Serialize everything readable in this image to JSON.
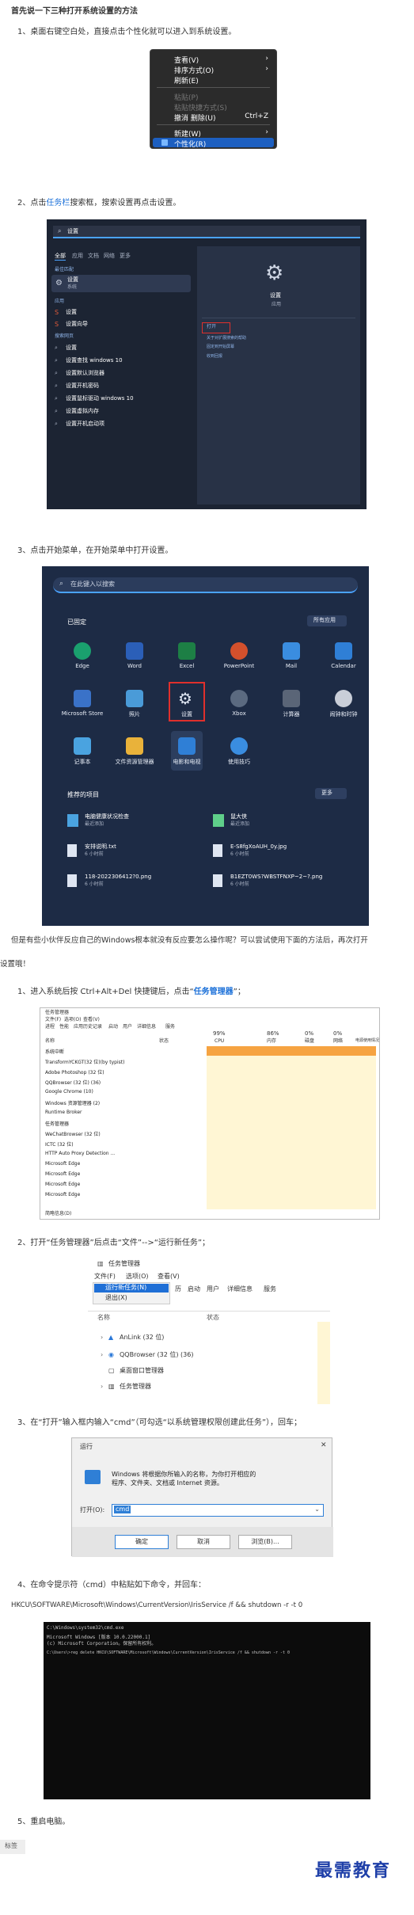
{
  "intro_heading": "首先说一下三种打开系统设置的方法",
  "step1": {
    "num": "1、",
    "text": "桌面右键空白处，直接点击个性化就可以进入到系统设置。"
  },
  "context_menu": {
    "items": [
      "查看(V)",
      "排序方式(O)",
      "刷新(E)",
      "粘贴(P)",
      "粘贴快捷方式(S)",
      "撤消 删除(U)",
      "新建(W)",
      "个性化(R)"
    ],
    "undo_shortcut": "Ctrl+Z"
  },
  "step2": {
    "num": "2、",
    "pre": "点击",
    "link": "任务栏",
    "post": "搜索框，搜索设置再点击设置。"
  },
  "search_panel": {
    "query": "设置",
    "tabs": [
      "全部",
      "应用",
      "文档",
      "网络",
      "更多"
    ],
    "best_match": "最佳匹配",
    "best_title": "设置",
    "best_sub": "系统",
    "apps_label": "应用",
    "apps": [
      "设置",
      "设置向导"
    ],
    "web_label": "搜索网页",
    "web": [
      "设置",
      "设置查找 windows 10",
      "设置默认浏览器",
      "设置开机密码",
      "设置鼠标驱动 windows 10",
      "设置虚拟内存",
      "设置开机启动项"
    ],
    "right_title": "设置",
    "right_sub": "应用",
    "actions": [
      "打开",
      "关于对扩展搜索的帮助",
      "固定到开始屏幕",
      "收到回报"
    ]
  },
  "step3": {
    "num": "3、",
    "text": "点击开始菜单，在开始菜单中打开设置。"
  },
  "start_menu": {
    "search": "在此键入以搜索",
    "pinned": "已固定",
    "all_apps": "所有应用",
    "apps": [
      "Edge",
      "Word",
      "Excel",
      "PowerPoint",
      "Mail",
      "Calendar",
      "Microsoft Store",
      "照片",
      "设置",
      "Xbox",
      "计算器",
      "闹钟和时钟",
      "记事本",
      "文件资源管理器",
      "电影和电视",
      "使用技巧"
    ],
    "recommended": "推荐的项目",
    "more": "更多",
    "recs": [
      {
        "title": "电脑健康状况检查",
        "sub": "最近添加"
      },
      {
        "title": "鼠大侠",
        "sub": "最近添加"
      },
      {
        "title": "安排说明.txt",
        "sub": "6 小时前"
      },
      {
        "title": "E-S8fgXoAUH_0y.jpg",
        "sub": "6 小时前"
      },
      {
        "title": "118-2022306412?0.png",
        "sub": "6 小时前"
      },
      {
        "title": "B1EZT0WS?WBSTFNXP~2~?.png",
        "sub": "6 小时前"
      }
    ]
  },
  "para": {
    "line1": "但是有些小伙伴反应自己的Windows根本就没有反应要怎么操作呢？可以尝试使用下面的方法后，再次打开",
    "line2": "设置哦！"
  },
  "s1": {
    "num": "1、",
    "pre": "进入系统后按 Ctrl+Alt+Del 快捷键后，点击“",
    "link": "任务管理器",
    "post": "”；"
  },
  "taskmgr": {
    "title": "任务管理器",
    "menu": [
      "文件(F)",
      "选项(O)",
      "查看(V)"
    ],
    "tabs": [
      "进程",
      "性能",
      "应用历史记录",
      "启动",
      "用户",
      "详细信息",
      "服务"
    ],
    "percents": [
      "99%",
      "86%",
      "0%",
      "0%"
    ],
    "cols": [
      "名称",
      "状态",
      "CPU",
      "内存",
      "磁盘",
      "网络",
      "电源使用情况"
    ],
    "rows": [
      "系统中断",
      "TransformYCKGT(32 位)(by typist)",
      "Adobe Photoshop (32 位)",
      "QQBrowser (32 位) (36)",
      "Google Chrome (10)",
      "Windows 资源管理器 (2)",
      "Runtime Broker",
      "任务管理器",
      "WeChatBrowser (32 位)",
      "ICTC (32 位)",
      "HTTP Auto Proxy Detection ...",
      "Microsoft Edge",
      "Microsoft Edge",
      "Microsoft Edge",
      "Microsoft Edge"
    ],
    "footer": "简略信息(D)"
  },
  "s2": {
    "num": "2、",
    "text": "打开“任务管理器”后点击“文件”-->“运行新任务”；"
  },
  "tm_menu": {
    "title": "任务管理器",
    "menu": [
      "文件(F)",
      "选项(O)",
      "查看(V)"
    ],
    "items": [
      "运行新任务(N)",
      "退出(X)"
    ],
    "tabs_visible": [
      "历",
      "启动",
      "用户",
      "详细信息",
      "服务"
    ],
    "col_name": "名称",
    "col_status": "状态",
    "procs": [
      "AnLink (32 位)",
      "QQBrowser (32 位) (36)",
      "桌面窗口管理器",
      "任务管理器"
    ]
  },
  "s3": {
    "num": "3、",
    "text": "在“打开”输入框内输入“cmd”（可勾选“以系统管理权限创建此任务”），回车；"
  },
  "run_dialog": {
    "title": "运行",
    "desc": "Windows 将根据你所输入的名称，为你打开相应的程序、文件夹、文档或 Internet 资源。",
    "open_label": "打开(O):",
    "value": "cmd",
    "buttons": [
      "确定",
      "取消",
      "浏览(B)..."
    ]
  },
  "s4": {
    "num": "4、",
    "text": "在命令提示符（cmd）中粘贴如下命令，并回车："
  },
  "command": "HKCU\\SOFTWARE\\Microsoft\\Windows\\CurrentVersion\\IrisService /f && shutdown -r -t 0",
  "cmd_window": {
    "title": "C:\\Windows\\system32\\cmd.exe",
    "lines": [
      "Microsoft Windows [版本 10.0.22000.1]",
      "(c) Microsoft Corporation。保留所有权利。",
      "C:\\Users\\>reg delete HKCU\\SOFTWARE\\Microsoft\\Windows\\CurrentVersion\\IrisService /f && shutdown -r -t 0"
    ]
  },
  "s5": {
    "num": "5、",
    "text": "重启电脑。"
  },
  "tag_label": "标签",
  "watermark": "最需教育"
}
